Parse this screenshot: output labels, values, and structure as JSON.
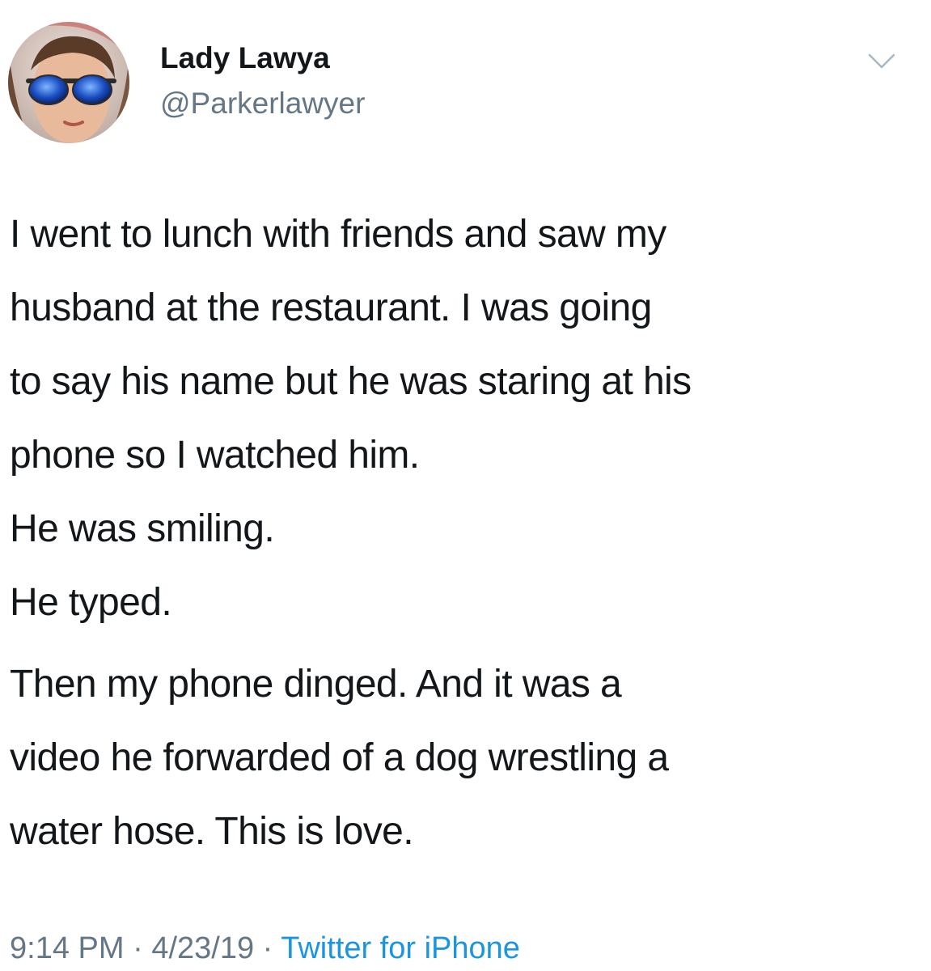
{
  "tweet": {
    "author": {
      "display_name": "Lady Lawya",
      "handle": "@Parkerlawyer"
    },
    "body_lines": [
      "I went to lunch with friends and saw my",
      "husband at the restaurant. I was going",
      "to say his name but he was staring at his",
      "phone so I watched him.",
      "He was smiling.",
      "He typed.",
      "Then my phone dinged. And it was a",
      "video he forwarded of a dog wrestling a",
      "water hose. This is love."
    ],
    "time": "9:14 PM",
    "separator": "·",
    "date": "4/23/19",
    "source": "Twitter for iPhone",
    "icons": {
      "menu": "chevron-down-icon"
    },
    "colors": {
      "text": "#14171a",
      "secondary": "#657786",
      "link": "#1b95e0"
    }
  }
}
